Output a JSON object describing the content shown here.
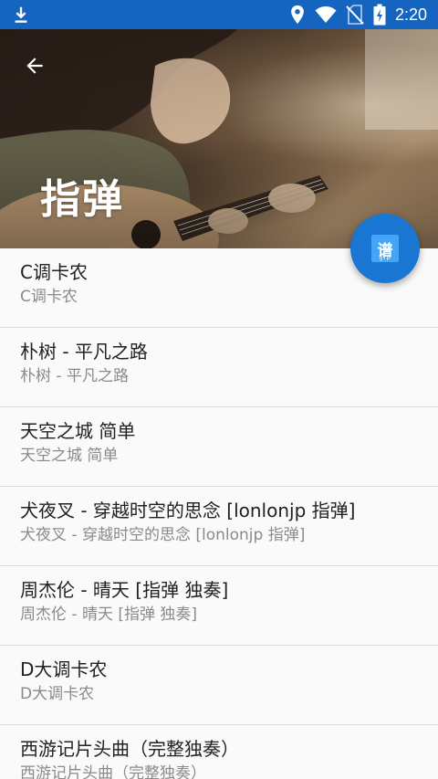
{
  "status_bar": {
    "time": "2:20",
    "icons": [
      "download-icon",
      "location-icon",
      "wifi-icon",
      "no-sim-icon",
      "battery-charging-icon"
    ]
  },
  "header": {
    "title": "指弹",
    "back_icon": "arrow-left-icon"
  },
  "fab": {
    "icon": "tab-book-icon",
    "glyph": "谱",
    "sub": "gtp"
  },
  "songs": [
    {
      "title": "C调卡农",
      "subtitle": "C调卡农"
    },
    {
      "title": "朴树 - 平凡之路",
      "subtitle": "朴树 - 平凡之路"
    },
    {
      "title": "天空之城 简单",
      "subtitle": "天空之城 简单"
    },
    {
      "title": "犬夜叉 - 穿越时空的思念 [lonlonjp 指弹]",
      "subtitle": "犬夜叉 - 穿越时空的思念 [lonlonjp 指弹]"
    },
    {
      "title": "周杰伦 - 晴天 [指弹 独奏]",
      "subtitle": "周杰伦 - 晴天 [指弹 独奏]"
    },
    {
      "title": "D大调卡农",
      "subtitle": "D大调卡农"
    },
    {
      "title": "西游记片头曲（完整独奏）",
      "subtitle": "西游记片头曲（完整独奏）"
    }
  ],
  "colors": {
    "status_bar": "#1565c0",
    "fab": "#1976d2",
    "fab_icon": "#42a5f5"
  }
}
